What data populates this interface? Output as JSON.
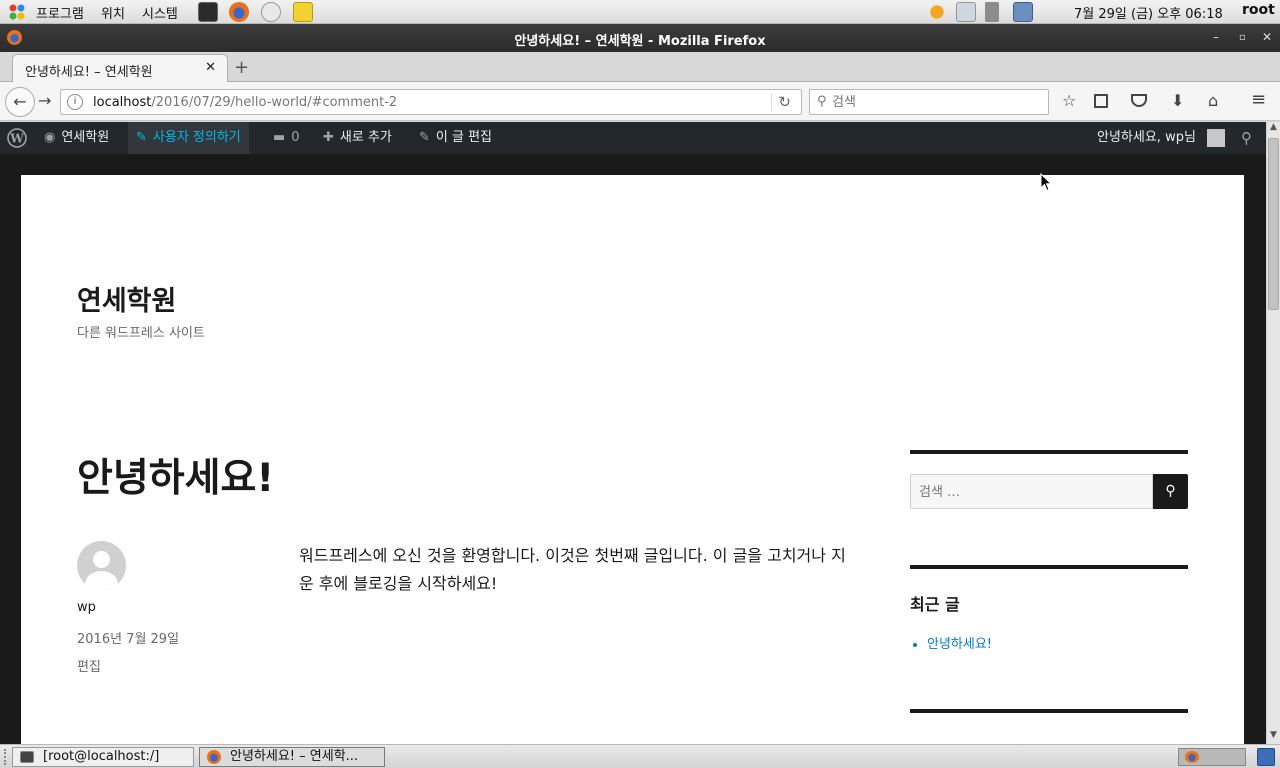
{
  "top_panel": {
    "menus": [
      "프로그램",
      "위치",
      "시스템"
    ],
    "clock": "7월 29일 (금) 오후 06:18",
    "user": "root"
  },
  "window": {
    "title": "안녕하세요! – 연세학원 - Mozilla Firefox"
  },
  "tabs": [
    {
      "label": "안녕하세요! – 연세학원"
    }
  ],
  "urlbar": {
    "host": "localhost",
    "path": "/2016/07/29/hello-world/#comment-2"
  },
  "search": {
    "placeholder": "검색"
  },
  "admin_bar": {
    "site_name": "연세학원",
    "customize": "사용자 정의하기",
    "comments_count": "0",
    "new": "새로 추가",
    "edit_post": "이 글 편집",
    "greeting": "안녕하세요, wp님"
  },
  "site": {
    "title": "연세학원",
    "description": "다른 워드프레스 사이트"
  },
  "post": {
    "title": "안녕하세요!",
    "author": "wp",
    "date": "2016년 7월 29일",
    "edit": "편집",
    "body": "워드프레스에 오신 것을 환영합니다. 이것은 첫번째 글입니다. 이 글을 고치거나 지운 후에 블로깅을 시작하세요!"
  },
  "sidebar": {
    "search_placeholder": "검색 …",
    "recent_title": "최근 글",
    "recent_posts": [
      "안녕하세요!"
    ]
  },
  "taskbar": {
    "items": [
      "[root@localhost:/]",
      "안녕하세요! – 연세학..."
    ]
  },
  "colors": {
    "wp_admin_bar": "#23282d",
    "wp_accent": "#00b9eb",
    "link": "#007acc"
  }
}
